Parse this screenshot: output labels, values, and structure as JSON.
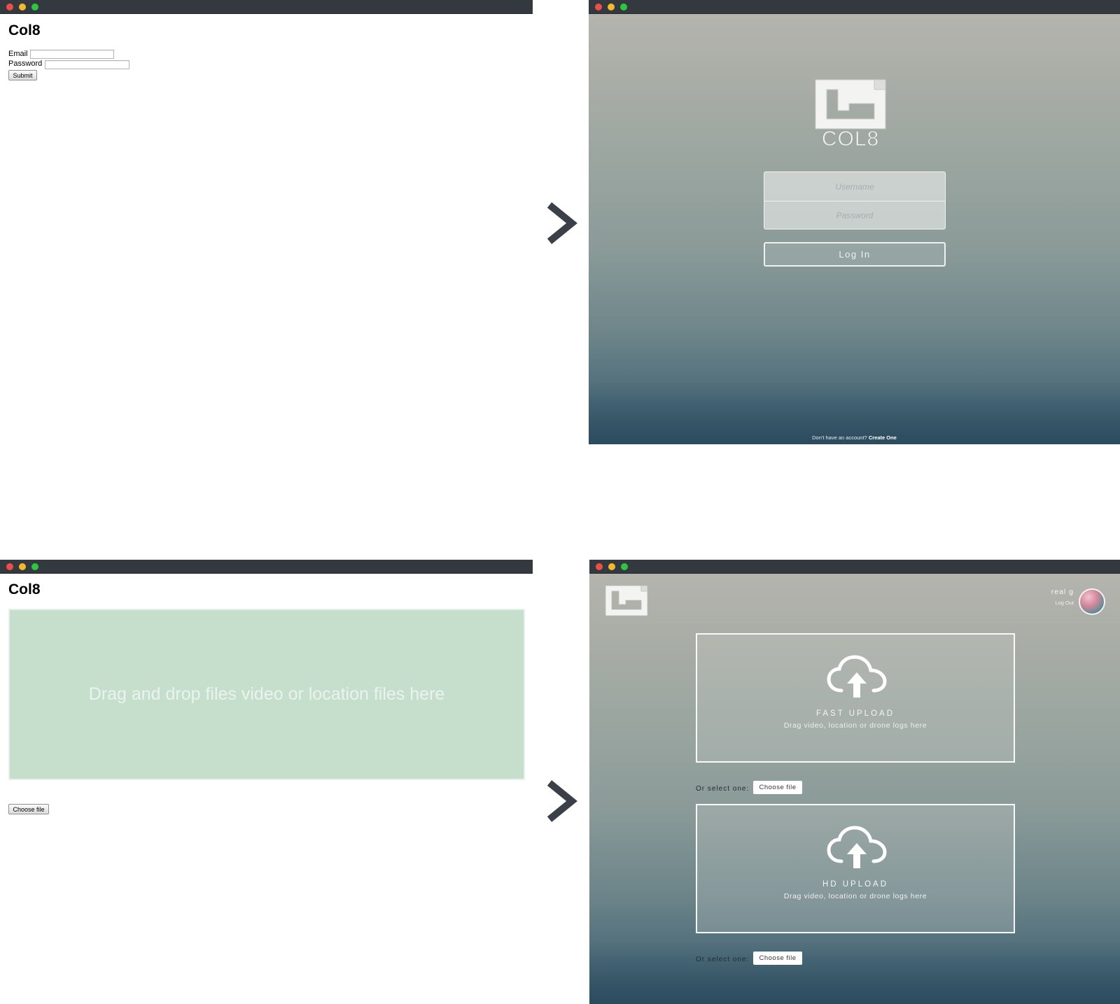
{
  "plain_login": {
    "title": "Col8",
    "email_label": "Email",
    "password_label": "Password",
    "submit_label": "Submit"
  },
  "styled_login": {
    "logo_text": "COL8",
    "username_placeholder": "Username",
    "password_placeholder": "Password",
    "login_label": "Log In",
    "signup_text": "Don't have an account?",
    "signup_link": "Create One"
  },
  "plain_upload": {
    "title": "Col8",
    "dropzone_text": "Drag and drop files video or location files here",
    "choose_file_label": "Choose file"
  },
  "styled_upload": {
    "user_name": "real g",
    "logout_label": "Log Out",
    "fast": {
      "title": "FAST UPLOAD",
      "subtitle": "Drag video, location or drone logs here",
      "select_label": "Or select one:",
      "choose_file_label": "Choose file"
    },
    "hd": {
      "title": "HD UPLOAD",
      "subtitle": "Drag video, location or drone logs here",
      "select_label": "Or select one:",
      "choose_file_label": "Choose file"
    }
  },
  "icons": {
    "transition_arrow": "chevron-right-icon",
    "upload": "cloud-upload-icon",
    "logo": "col8-logo"
  },
  "colors": {
    "titlebar": "#34383f",
    "dropzone": "#c6dfcc",
    "arrow": "#3a3f48"
  }
}
